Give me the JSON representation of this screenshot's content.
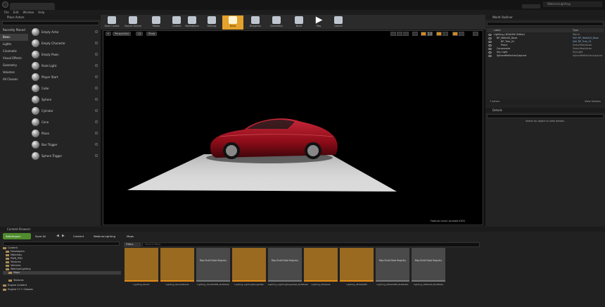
{
  "menu": [
    "File",
    "Edit",
    "Window",
    "Help"
  ],
  "project_name": "WebinarLighting",
  "modes": {
    "title": "Place Actors",
    "categories": [
      "Recently Placed",
      "Basic",
      "Lights",
      "Cinematic",
      "Visual Effects",
      "Geometry",
      "Volumes",
      "All Classes"
    ],
    "selected_category": "Basic",
    "items": [
      "Empty Actor",
      "Empty Character",
      "Empty Pawn",
      "Point Light",
      "Player Start",
      "Cube",
      "Sphere",
      "Cylinder",
      "Cone",
      "Plane",
      "Box Trigger",
      "Sphere Trigger"
    ]
  },
  "toolbar": [
    "Save Current",
    "Source Control",
    "Modes",
    "Content",
    "Marketplace",
    "Settings",
    "Build",
    "Blueprints",
    "Cinematics",
    "Build",
    "Play",
    "Launch"
  ],
  "viewport": {
    "perspective_label": "Perspective",
    "lit_label": "Lit",
    "show_label": "Show",
    "fov": "10",
    "feature_level": "Feature Level: Android ES31"
  },
  "outliner": {
    "title": "World Outliner",
    "col_label": "Label",
    "col_type": "Type",
    "rows": [
      {
        "label": "Lighting_UE4AGW (Editor)",
        "type": "World",
        "type_gray": true
      },
      {
        "label": "BP_WebAGI_Base",
        "type": "Edit BP_WebAGI_Base",
        "type_gray": false
      },
      {
        "label": "BP_Tree_01",
        "type": "Edit BP_Tree_01",
        "type_gray": false
      },
      {
        "label": "Plane",
        "type": "StaticMeshActor",
        "type_gray": true
      },
      {
        "label": "Carrosserie",
        "type": "StaticMeshActor",
        "type_gray": true
      },
      {
        "label": "Sky Light",
        "type": "SkyLight",
        "type_gray": true
      },
      {
        "label": "SphereReflectionCapture",
        "type": "SphereReflectionCapture",
        "type_gray": true
      }
    ],
    "actors_count": "7 actors",
    "view_options": "View Options"
  },
  "details": {
    "title": "Details",
    "empty_msg": "Select an object to view details."
  },
  "content_browser": {
    "title": "Content Browser",
    "add_new": "Add/Import",
    "save_all": "Save All",
    "breadcrumb": [
      "Content",
      "WebinarLighting",
      "Maps"
    ],
    "search_folders_placeholder": "Search Folders",
    "search_assets_placeholder": "Search Maps",
    "filters_label": "Filters",
    "tree": [
      {
        "label": "Content",
        "indent": 0,
        "selected": false
      },
      {
        "label": "Developers",
        "indent": 1,
        "selected": false
      },
      {
        "label": "Materials",
        "indent": 1,
        "selected": false
      },
      {
        "label": "PWR_PSD",
        "indent": 1,
        "selected": false
      },
      {
        "label": "Textures",
        "indent": 1,
        "selected": false
      },
      {
        "label": "Vehicles",
        "indent": 1,
        "selected": false
      },
      {
        "label": "WebinarLighting",
        "indent": 1,
        "selected": false
      },
      {
        "label": "Maps",
        "indent": 2,
        "selected": true
      },
      {
        "label": "Textures",
        "indent": 2,
        "selected": false
      },
      {
        "label": "Engine Content",
        "indent": 0,
        "selected": false
      },
      {
        "label": "Engine C++ Classes",
        "indent": 0,
        "selected": false
      }
    ],
    "assets": [
      {
        "name": "Lighting_Studio",
        "kind": "map",
        "thumb_text": ""
      },
      {
        "name": "Lighting_StudioMobile",
        "kind": "map",
        "thumb_text": ""
      },
      {
        "name": "Lighting_StudioMOB_BuiltData",
        "kind": "data",
        "thumb_text": "Map Build Data Registry"
      },
      {
        "name": "Lighting_LightingDesignNet",
        "kind": "map",
        "thumb_text": ""
      },
      {
        "name": "Lighting_LightingDesignNet_BuiltData",
        "kind": "data",
        "thumb_text": "Map Build Data Registry"
      },
      {
        "name": "Lighting_UE4AGW",
        "kind": "map",
        "thumb_text": ""
      },
      {
        "name": "Lighting_UE4AGWM",
        "kind": "map",
        "thumb_text": ""
      },
      {
        "name": "Lighting_UE4AGWM_BuiltData",
        "kind": "data",
        "thumb_text": "Map Build Data Registry"
      },
      {
        "name": "Lighting_UE4AGW_BuiltData",
        "kind": "data",
        "thumb_text": "Map Build Data Registry"
      }
    ]
  },
  "colors": {
    "accent_orange": "#e3a22b",
    "add_new_green": "#4f8c2d",
    "car_red": "#9c0f1b"
  }
}
